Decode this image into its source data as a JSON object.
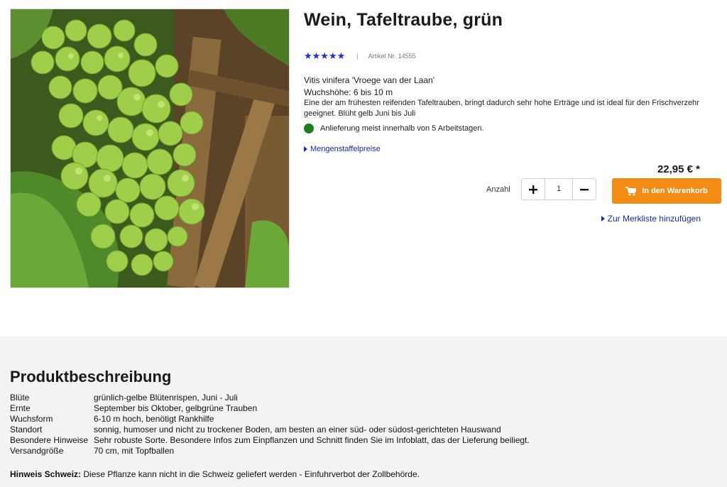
{
  "product": {
    "title": "Wein, Tafeltraube, grün",
    "stars": "★★★★★",
    "separator": "|",
    "article_label": "Artikel Nr.",
    "article_number": "14555",
    "latin_name": "Vitis vinifera 'Vroege van der Laan'",
    "height_line": "Wuchshöhe: 6 bis 10 m",
    "description": "Eine der am frühesten reifenden Tafeltrauben, bringt dadurch sehr hohe Erträge und ist ideal für den Frischverzehr geeignet. Blüht gelb Juni bis Juli",
    "delivery": "Anlieferung meist innerhalb von 5 Arbeitstagen.",
    "delivery_color": "#1a7f1a",
    "tier_pricing_link": "Mengenstaffelpreise",
    "price": "22,95 € *",
    "quantity_label": "Anzahl",
    "quantity": "1",
    "add_to_cart": "In den Warenkorb",
    "wishlist_link": "Zur Merkliste hinzufügen",
    "accent_color": "#f28c14",
    "link_color": "#1a2aa6"
  },
  "description_section": {
    "title": "Produktbeschreibung",
    "rows": [
      {
        "label": "Blüte",
        "value": "grünlich-gelbe Blütenrispen, Juni - Juli"
      },
      {
        "label": "Ernte",
        "value": "September bis Oktober, gelbgrüne Trauben"
      },
      {
        "label": "Wuchsform",
        "value": "6-10 m hoch, benötigt Rankhilfe"
      },
      {
        "label": "Standort",
        "value": "sonnig, humoser und nicht zu trockener Boden, am besten an einer süd- oder südost-gerichteten Hauswand"
      },
      {
        "label": "Besondere Hinweise",
        "value": "Sehr robuste Sorte. Besondere Infos zum Einpflanzen und Schnitt finden Sie im Infoblatt, das der Lieferung beiliegt."
      },
      {
        "label": "Versandgröße",
        "value": "70 cm, mit Topfballen"
      }
    ],
    "note_label": "Hinweis Schweiz:",
    "note_text": " Diese Pflanze kann nicht in die Schweiz geliefert werden - Einfuhrverbot der Zollbehörde."
  }
}
